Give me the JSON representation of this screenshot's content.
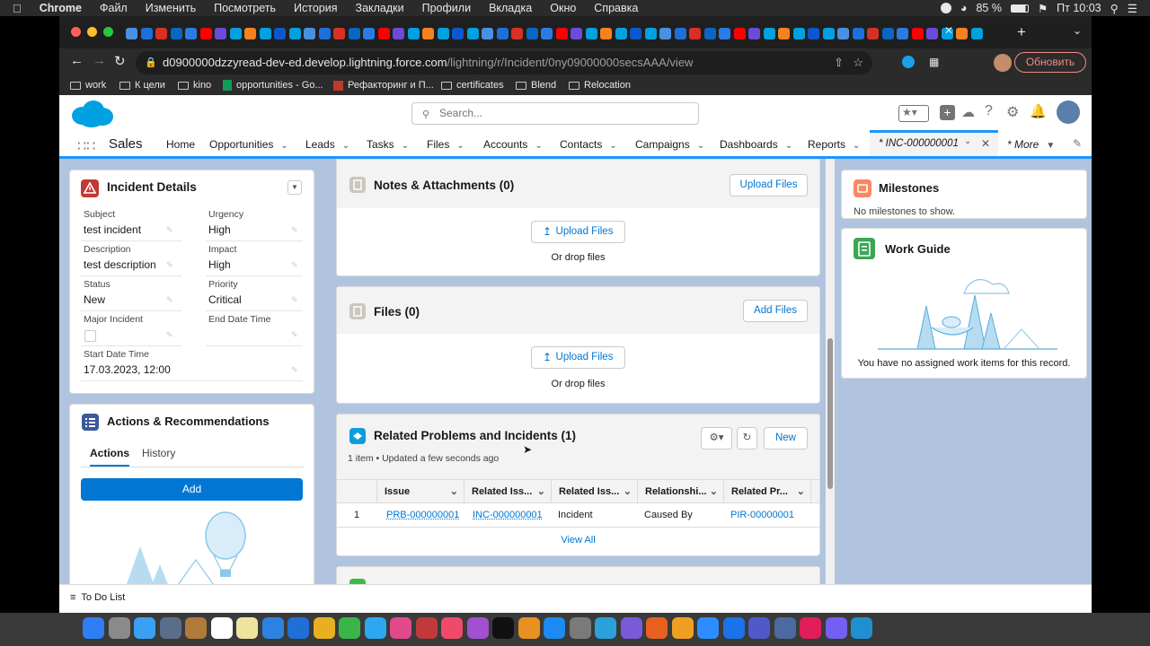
{
  "mac_menu": {
    "app": "Chrome",
    "items": [
      "Файл",
      "Изменить",
      "Посмотреть",
      "История",
      "Закладки",
      "Профили",
      "Вкладка",
      "Окно",
      "Справка"
    ],
    "battery": "85 %",
    "clock": "Пт 10:03"
  },
  "browser": {
    "url_host": "d0900000dzzyread-dev-ed.develop.lightning.force.com",
    "url_path": "/lightning/r/Incident/0ny09000000secsAAA/view",
    "update_label": "Обновить",
    "bookmarks": [
      "work",
      "К цели",
      "kino",
      "opportunities - Go...",
      "Рефакторинг и П...",
      "certificates",
      "Blend",
      "Relocation"
    ]
  },
  "sf": {
    "search_placeholder": "Search...",
    "app_name": "Sales",
    "nav": [
      "Home",
      "Opportunities",
      "Leads",
      "Tasks",
      "Files",
      "Accounts",
      "Contacts",
      "Campaigns",
      "Dashboards",
      "Reports"
    ],
    "active_tab": "* INC-000000001",
    "more": "* More"
  },
  "incident_details": {
    "title": "Incident Details",
    "fields": [
      {
        "label": "Subject",
        "value": "test incident"
      },
      {
        "label": "Urgency",
        "value": "High"
      },
      {
        "label": "Description",
        "value": "test description"
      },
      {
        "label": "Impact",
        "value": "High"
      },
      {
        "label": "Status",
        "value": "New"
      },
      {
        "label": "Priority",
        "value": "Critical"
      },
      {
        "label": "Major Incident",
        "value": ""
      },
      {
        "label": "End Date Time",
        "value": ""
      },
      {
        "label": "Start Date Time",
        "value": "17.03.2023, 12:00"
      }
    ]
  },
  "actions": {
    "title": "Actions & Recommendations",
    "tabs": [
      "Actions",
      "History"
    ],
    "add_label": "Add"
  },
  "notes": {
    "title": "Notes & Attachments (0)",
    "upload_label": "Upload Files",
    "drop_text": "Or drop files"
  },
  "files": {
    "title": "Files (0)",
    "add_label": "Add Files",
    "upload_label": "Upload Files",
    "drop_text": "Or drop files"
  },
  "related": {
    "title": "Related Problems and Incidents (1)",
    "subtitle": "1 item • Updated a few seconds ago",
    "new_label": "New",
    "columns": [
      "Issue",
      "Related Iss...",
      "Related Iss...",
      "Relationshi...",
      "Related Pr..."
    ],
    "rows": [
      {
        "num": "1",
        "issue": "PRB-000000001",
        "related_issue": "INC-000000001",
        "related_type": "Incident",
        "relationship": "Caused By",
        "related_pr": "PIR-00000001"
      }
    ],
    "view_all": "View All"
  },
  "milestones": {
    "title": "Milestones",
    "empty": "No milestones to show."
  },
  "work_guide": {
    "title": "Work Guide",
    "empty": "You have no assigned work items for this record."
  },
  "utility": {
    "todo": "To Do List"
  },
  "colors": {
    "brand_blue": "#0176d3",
    "nav_active": "#1b96ff",
    "incident_red": "#c23934",
    "related_teal": "#0d9dda"
  }
}
